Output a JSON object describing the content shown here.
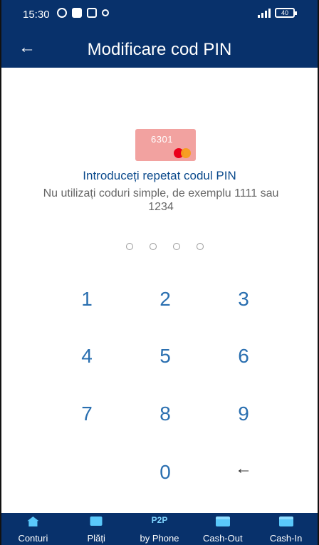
{
  "status_bar": {
    "time": "15:30",
    "battery": "40",
    "icons": [
      "alarm-icon",
      "video-icon",
      "music-icon",
      "person-icon",
      "signal-icon",
      "battery-icon"
    ]
  },
  "header": {
    "title": "Modificare cod PIN",
    "back_icon": "←"
  },
  "card": {
    "last_digits": "6301",
    "brand_icon": "mastercard-logo"
  },
  "instructions": {
    "title": "Introduceți repetat codul PIN",
    "subtitle": "Nu utilizați coduri simple, de exemplu 1111 sau 1234"
  },
  "pin": {
    "length": 4
  },
  "keypad": {
    "keys": [
      "1",
      "2",
      "3",
      "4",
      "5",
      "6",
      "7",
      "8",
      "9",
      "0"
    ],
    "backspace": "←"
  },
  "tabbar": {
    "tabs": [
      {
        "label": "Conturi",
        "icon": "home-icon"
      },
      {
        "label": "Plăți",
        "icon": "card-icon"
      },
      {
        "label": "by Phone",
        "tag": "P2P"
      },
      {
        "label": "Cash-Out",
        "icon": "atm-icon"
      },
      {
        "label": "Cash-In",
        "icon": "atm-icon"
      }
    ]
  },
  "colors": {
    "primary": "#08316b",
    "accent": "#0b4a8c",
    "digit": "#2a6fb0",
    "card": "#f2a2a0"
  }
}
